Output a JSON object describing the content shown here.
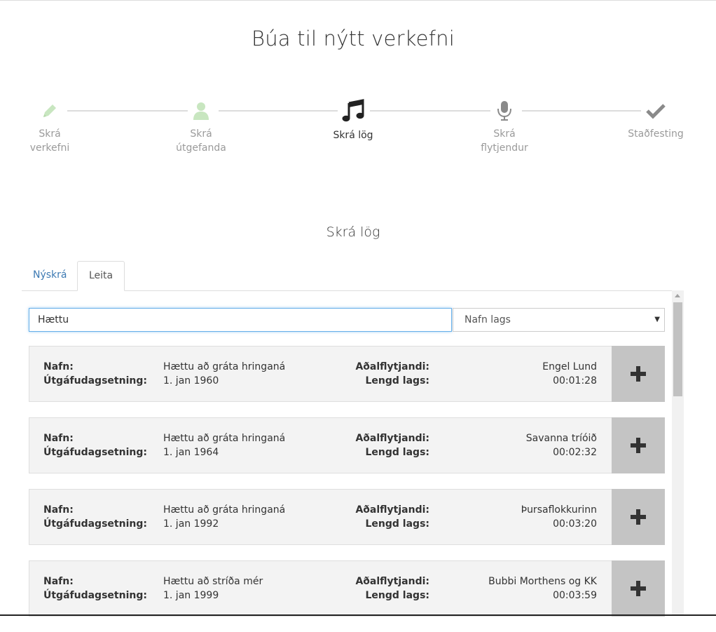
{
  "header": {
    "title": "Búa til nýtt verkefni"
  },
  "stepper": {
    "steps": [
      {
        "line1": "Skrá",
        "line2": "verkefni",
        "icon": "pencil-icon",
        "state": "done"
      },
      {
        "line1": "Skrá",
        "line2": "útgefanda",
        "icon": "user-icon",
        "state": "done"
      },
      {
        "line1": "Skrá lög",
        "line2": "",
        "icon": "music-note-icon",
        "state": "active"
      },
      {
        "line1": "Skrá",
        "line2": "flytjendur",
        "icon": "microphone-icon",
        "state": "todo"
      },
      {
        "line1": "Staðfesting",
        "line2": "",
        "icon": "checkmark-icon",
        "state": "todo"
      }
    ]
  },
  "section": {
    "title": "Skrá lög"
  },
  "tabs": {
    "new_label": "Nýskrá",
    "search_label": "Leita",
    "active": "Leita"
  },
  "search": {
    "value": "Hættu",
    "placeholder": "",
    "field_selected": "Nafn lags"
  },
  "labels": {
    "name": "Nafn:",
    "release_date": "Útgáfudagsetning:",
    "main_artist": "Aðalflytjandi:",
    "song_length": "Lengd lags:"
  },
  "results": [
    {
      "name": "Hættu að gráta hringaná",
      "date": "1. jan 1960",
      "artist": "Engel Lund",
      "length": "00:01:28"
    },
    {
      "name": "Hættu að gráta hringaná",
      "date": "1. jan 1964",
      "artist": "Savanna tríóið",
      "length": "00:02:32"
    },
    {
      "name": "Hættu að gráta hringaná",
      "date": "1. jan 1992",
      "artist": "Þursaflokkurinn",
      "length": "00:03:20"
    },
    {
      "name": "Hættu að stríða mér",
      "date": "1. jan 1999",
      "artist": "Bubbi Morthens og KK",
      "length": "00:03:59"
    }
  ],
  "colors": {
    "done_icon": "#c8e6c0",
    "active_icon": "#222222",
    "todo_icon": "#8a8a8a",
    "link": "#3d7ab3",
    "card_bg": "#f3f3f3",
    "add_button": "#c4c4c4"
  }
}
